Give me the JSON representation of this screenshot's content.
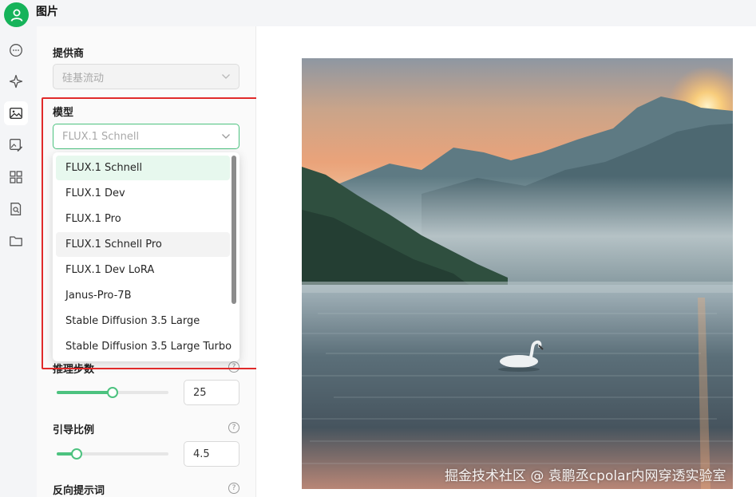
{
  "app": {
    "title": "图片"
  },
  "sidebar_icons": [
    "chat-bubble-icon",
    "sparkle-icon",
    "image-icon",
    "image-edit-icon",
    "grid-icon",
    "document-search-icon",
    "folder-icon"
  ],
  "settings": {
    "provider": {
      "label": "提供商",
      "value": "硅基流动"
    },
    "model": {
      "label": "模型",
      "placeholder": "FLUX.1 Schnell",
      "options": [
        "FLUX.1 Schnell",
        "FLUX.1 Dev",
        "FLUX.1 Pro",
        "FLUX.1 Schnell Pro",
        "FLUX.1 Dev LoRA",
        "Janus-Pro-7B",
        "Stable Diffusion 3.5 Large",
        "Stable Diffusion 3.5 Large Turbo"
      ],
      "selected": "FLUX.1 Schnell",
      "hovered": "FLUX.1 Schnell Pro"
    },
    "steps": {
      "label": "推理步数",
      "value": "25",
      "level": 0.5
    },
    "guidance": {
      "label": "引导比例",
      "value": "4.5",
      "level": 0.18
    },
    "negative_prompt": {
      "label": "反向提示词"
    },
    "help_glyph": "?"
  },
  "preview": {
    "watermark": "掘金技术社区 @ 袁鹏丞cpolar内网穿透实验室"
  },
  "colors": {
    "accent": "#4cc27f",
    "brand": "#16b35a",
    "annotation": "#e02a2a"
  }
}
